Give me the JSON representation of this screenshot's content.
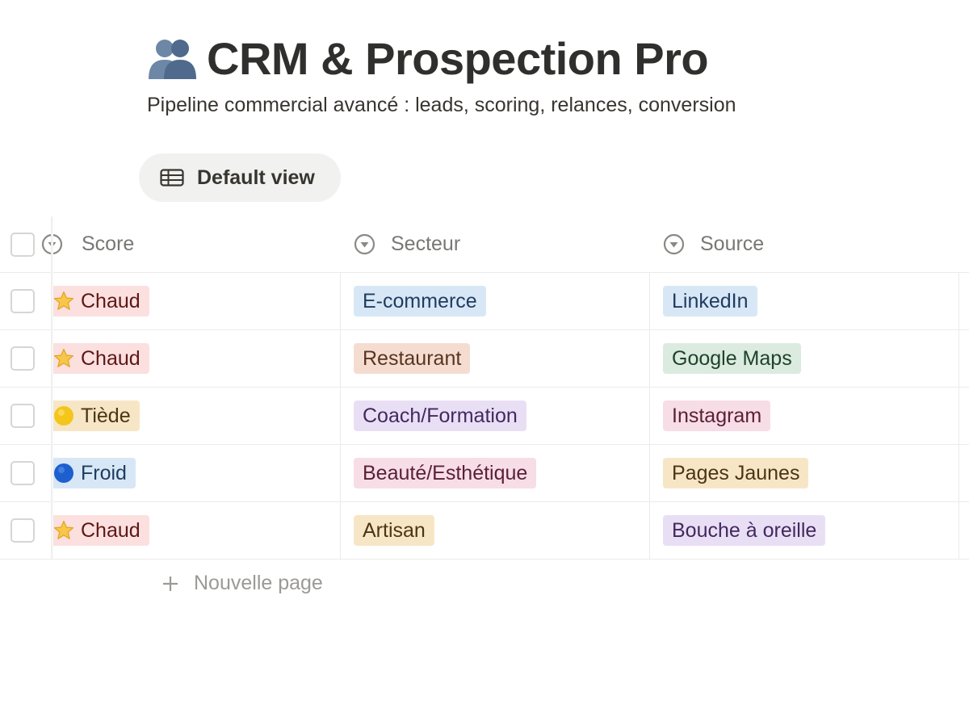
{
  "header": {
    "title": "CRM & Prospection Pro",
    "icon": "busts-in-silhouette-icon",
    "subtitle": "Pipeline commercial avancé : leads, scoring, relances, conversion"
  },
  "view": {
    "label": "Default view",
    "icon": "table-icon"
  },
  "table": {
    "columns": [
      {
        "label": "Score",
        "icon": "select-icon"
      },
      {
        "label": "Secteur",
        "icon": "select-icon"
      },
      {
        "label": "Source",
        "icon": "select-icon"
      }
    ],
    "rows": [
      {
        "score": {
          "label": "Chaud",
          "emoji": "star-icon",
          "bg": "#fbe0df",
          "fg": "#5d1715"
        },
        "secteur": {
          "label": "E-commerce",
          "bg": "#d8e7f6",
          "fg": "#1f3c5f"
        },
        "source": {
          "label": "LinkedIn",
          "bg": "#d8e7f6",
          "fg": "#1f3c5f"
        }
      },
      {
        "score": {
          "label": "Chaud",
          "emoji": "star-icon",
          "bg": "#fbe0df",
          "fg": "#5d1715"
        },
        "secteur": {
          "label": "Restaurant",
          "bg": "#f4ddd0",
          "fg": "#5a3420"
        },
        "source": {
          "label": "Google Maps",
          "bg": "#dbebe0",
          "fg": "#1f4229"
        }
      },
      {
        "score": {
          "label": "Tiède",
          "emoji": "yellow-circle-icon",
          "bg": "#f7e6c6",
          "fg": "#4b3512"
        },
        "secteur": {
          "label": "Coach/Formation",
          "bg": "#e9dff5",
          "fg": "#43285f"
        },
        "source": {
          "label": "Instagram",
          "bg": "#f7dde6",
          "fg": "#5a1f36"
        }
      },
      {
        "score": {
          "label": "Froid",
          "emoji": "blue-circle-icon",
          "bg": "#d8e7f6",
          "fg": "#1f3c5f"
        },
        "secteur": {
          "label": "Beauté/Esthétique",
          "bg": "#f7dde6",
          "fg": "#5a1f36"
        },
        "source": {
          "label": "Pages Jaunes",
          "bg": "#f7e6c6",
          "fg": "#4b3512"
        }
      },
      {
        "score": {
          "label": "Chaud",
          "emoji": "star-icon",
          "bg": "#fbe0df",
          "fg": "#5d1715"
        },
        "secteur": {
          "label": "Artisan",
          "bg": "#f7e6c6",
          "fg": "#4b3512"
        },
        "source": {
          "label": "Bouche à oreille",
          "bg": "#e9dff5",
          "fg": "#43285f"
        }
      }
    ]
  },
  "new_page": {
    "label": "Nouvelle page"
  },
  "colors": {
    "text": "#37352f",
    "muted": "#787774",
    "border": "#ebebe9",
    "button_bg": "#f1f1ef"
  }
}
